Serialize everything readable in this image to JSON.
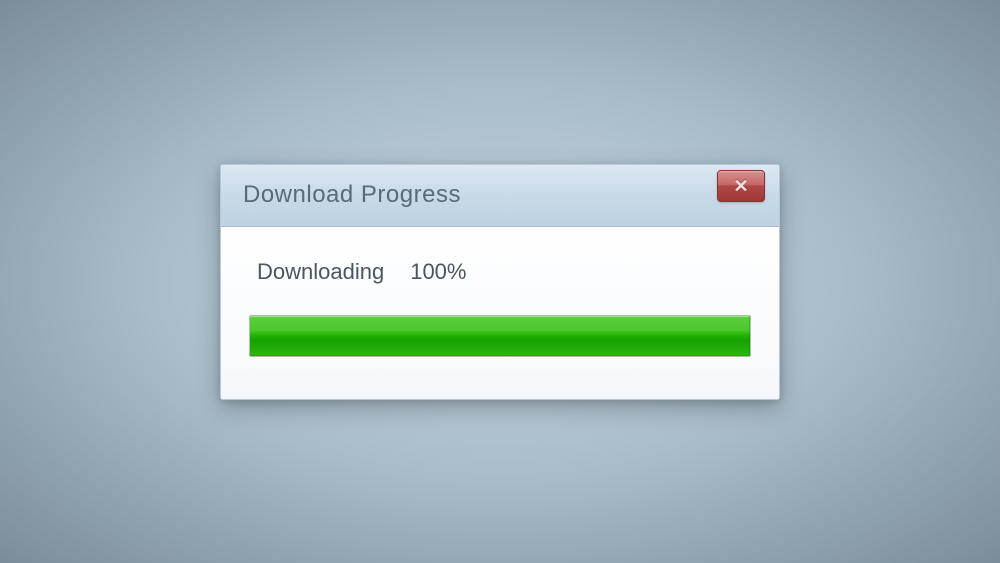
{
  "dialog": {
    "title": "Download Progress",
    "status_label": "Downloading",
    "percent_text": "100%",
    "progress_percent": 100
  }
}
